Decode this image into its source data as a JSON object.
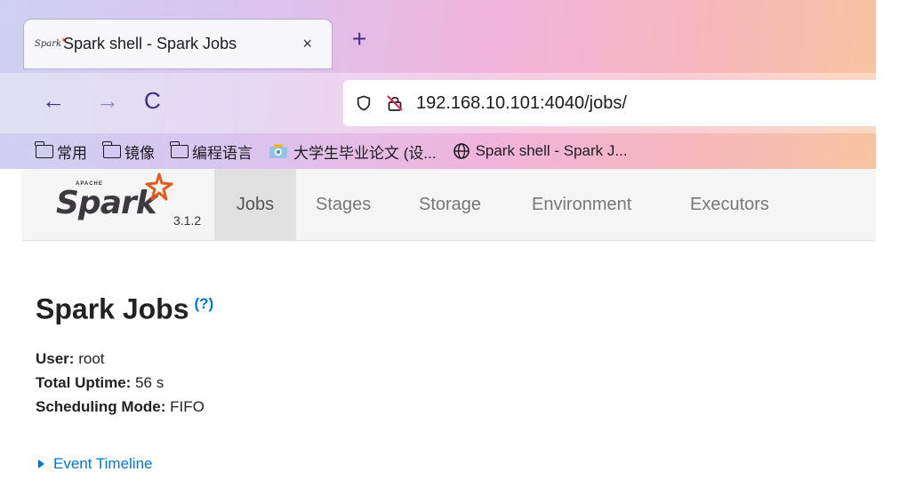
{
  "browser": {
    "tab_title": "Spark shell - Spark Jobs",
    "tab_favicon_text": "Spark",
    "close_glyph": "×",
    "new_tab_glyph": "+",
    "back_glyph": "←",
    "forward_glyph": "→",
    "reload_glyph": "C",
    "url": "192.168.10.101:4040/jobs/",
    "bookmarks": [
      {
        "label": "常用",
        "icon": "folder-icon"
      },
      {
        "label": "镜像",
        "icon": "folder-icon"
      },
      {
        "label": "编程语言",
        "icon": "folder-icon"
      },
      {
        "label": "大学生毕业论文 (设...",
        "icon": "image-icon"
      },
      {
        "label": "Spark shell - Spark J...",
        "icon": "globe-icon"
      }
    ]
  },
  "spark": {
    "brand_apache": "APACHE",
    "brand_name": "Spark",
    "version": "3.1.2",
    "nav_tabs": [
      "Jobs",
      "Stages",
      "Storage",
      "Environment",
      "Executors"
    ],
    "active_tab": "Jobs",
    "page_title": "Spark Jobs",
    "help_link": "(?)",
    "summary": {
      "user_label": "User:",
      "user_value": "root",
      "uptime_label": "Total Uptime:",
      "uptime_value": "56 s",
      "mode_label": "Scheduling Mode:",
      "mode_value": "FIFO"
    },
    "timeline_label": "Event Timeline"
  },
  "colors": {
    "link": "#0077cc",
    "spark_orange": "#e25a1c",
    "nav_active_bg": "#e1e1e1"
  }
}
